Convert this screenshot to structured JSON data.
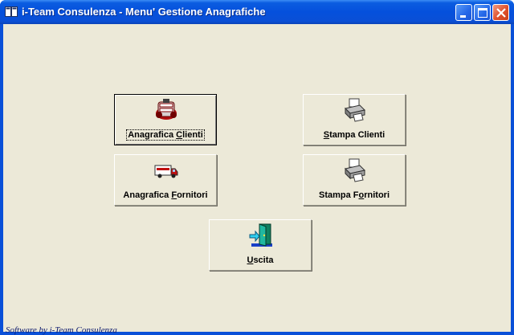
{
  "window": {
    "title": "i-Team Consulenza - Menu' Gestione Anagrafiche",
    "icon": "app-window-icon",
    "controls": [
      "minimize-icon",
      "maximize-icon",
      "close-icon"
    ]
  },
  "buttons": {
    "anagrafica_clienti": {
      "pre": "Anagrafica ",
      "key": "C",
      "post": "lienti",
      "icon": "filing-cabinet-icon"
    },
    "stampa_clienti": {
      "pre": "",
      "key": "S",
      "post": "tampa Clienti",
      "icon": "printer-icon"
    },
    "anagrafica_fornitori": {
      "pre": "Anagrafica ",
      "key": "F",
      "post": "ornitori",
      "icon": "delivery-truck-icon"
    },
    "stampa_fornitori": {
      "pre": "Stampa F",
      "key": "o",
      "post": "rnitori",
      "icon": "printer-icon"
    },
    "uscita": {
      "pre": "",
      "key": "U",
      "post": "scita",
      "icon": "exit-door-icon"
    }
  },
  "footer": {
    "text": "Software by i-Team Consulenza"
  }
}
